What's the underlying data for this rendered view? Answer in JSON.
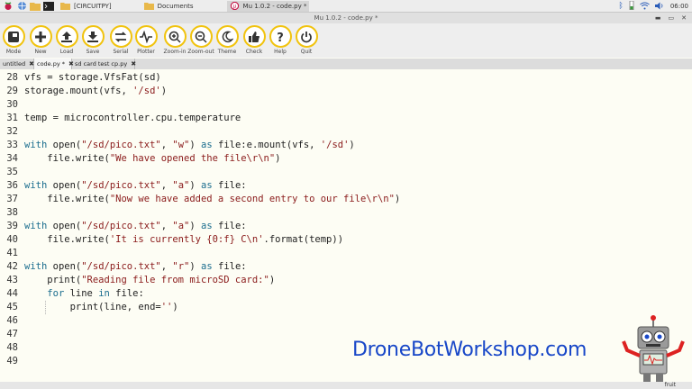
{
  "taskbar": {
    "tasks": [
      {
        "label": "[CIRCUITPY]"
      },
      {
        "label": "Documents"
      },
      {
        "label": "Mu 1.0.2 - code.py *"
      }
    ],
    "clock": "06:00"
  },
  "window": {
    "title": "Mu 1.0.2 - code.py *"
  },
  "toolbar": {
    "buttons": [
      {
        "label": "Mode",
        "icon": "mode-icon"
      },
      {
        "label": "New",
        "icon": "plus-icon"
      },
      {
        "label": "Load",
        "icon": "upload-icon"
      },
      {
        "label": "Save",
        "icon": "download-icon"
      },
      {
        "label": "Serial",
        "icon": "arrows-icon"
      },
      {
        "label": "Plotter",
        "icon": "waveform-icon"
      },
      {
        "label": "Zoom-in",
        "icon": "zoom-in-icon"
      },
      {
        "label": "Zoom-out",
        "icon": "zoom-out-icon"
      },
      {
        "label": "Theme",
        "icon": "moon-icon"
      },
      {
        "label": "Check",
        "icon": "thumbs-up-icon"
      },
      {
        "label": "Help",
        "icon": "question-icon"
      },
      {
        "label": "Quit",
        "icon": "power-icon"
      }
    ]
  },
  "tabs": [
    {
      "label": "untitled",
      "close": "✖"
    },
    {
      "label": "code.py *",
      "close": "✖"
    },
    {
      "label": "sd card test cp.py",
      "close": "✖"
    }
  ],
  "editor": {
    "lines": [
      {
        "num": "28",
        "code": "vfs = storage.VfsFat(sd)"
      },
      {
        "num": "29",
        "code": "storage.mount(vfs, '/sd')"
      },
      {
        "num": "30",
        "code": ""
      },
      {
        "num": "31",
        "code": "temp = microcontroller.cpu.temperature"
      },
      {
        "num": "32",
        "code": ""
      },
      {
        "num": "33",
        "code": "with open(\"/sd/pico.txt\", \"w\") as file:e.mount(vfs, '/sd')"
      },
      {
        "num": "34",
        "code": "    file.write(\"We have opened the file\\r\\n\")"
      },
      {
        "num": "35",
        "code": ""
      },
      {
        "num": "36",
        "code": "with open(\"/sd/pico.txt\", \"a\") as file:"
      },
      {
        "num": "37",
        "code": "    file.write(\"Now we have added a second entry to our file\\r\\n\")"
      },
      {
        "num": "38",
        "code": ""
      },
      {
        "num": "39",
        "code": "with open(\"/sd/pico.txt\", \"a\") as file:"
      },
      {
        "num": "40",
        "code": "    file.write('It is currently {0:f} C\\n'.format(temp))"
      },
      {
        "num": "41",
        "code": ""
      },
      {
        "num": "42",
        "code": "with open(\"/sd/pico.txt\", \"r\") as file:"
      },
      {
        "num": "43",
        "code": "    print(\"Reading file from microSD card:\")"
      },
      {
        "num": "44",
        "code": "    for line in file:"
      },
      {
        "num": "45",
        "code": "        print(line, end='')"
      },
      {
        "num": "46",
        "code": ""
      },
      {
        "num": "47",
        "code": ""
      },
      {
        "num": "48",
        "code": ""
      },
      {
        "num": "49",
        "code": ""
      }
    ]
  },
  "watermark": {
    "text": "DroneBotWorkshop.com"
  },
  "statusbar": {
    "mode": "fruit"
  },
  "colors": {
    "accent": "#f1c30d",
    "keyword": "#1b6d8e",
    "string": "#8a1a1a",
    "watermark": "#1847c8"
  }
}
